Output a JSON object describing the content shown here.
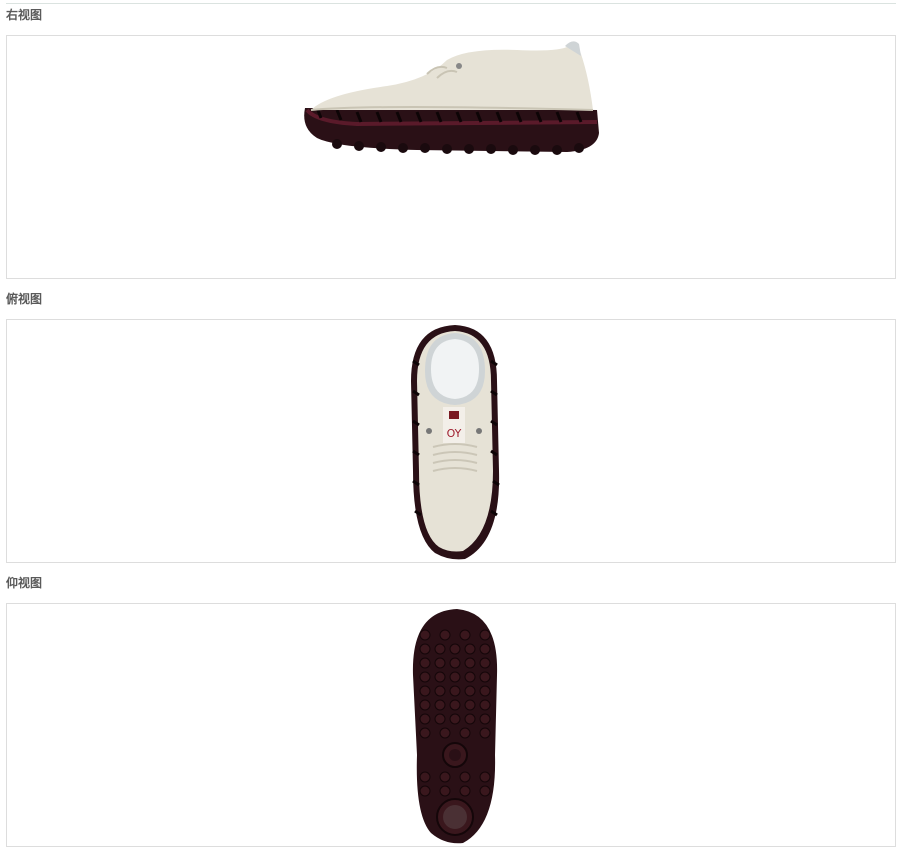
{
  "views": [
    {
      "id": "right",
      "label": "右视图",
      "image_name": "shoe-right-view-image"
    },
    {
      "id": "top",
      "label": "俯视图",
      "image_name": "shoe-top-view-image"
    },
    {
      "id": "bottom",
      "label": "仰视图",
      "image_name": "shoe-bottom-view-image"
    }
  ],
  "colors": {
    "upper": "#e6e2d6",
    "upper_shadow": "#c9c4b4",
    "sole": "#2a1016",
    "sole_stitch": "#5a1a2a",
    "lining": "#cfd4d6",
    "panel_border": "#dddddd",
    "label_text": "#5a5a5a"
  },
  "tag_text": "OY"
}
